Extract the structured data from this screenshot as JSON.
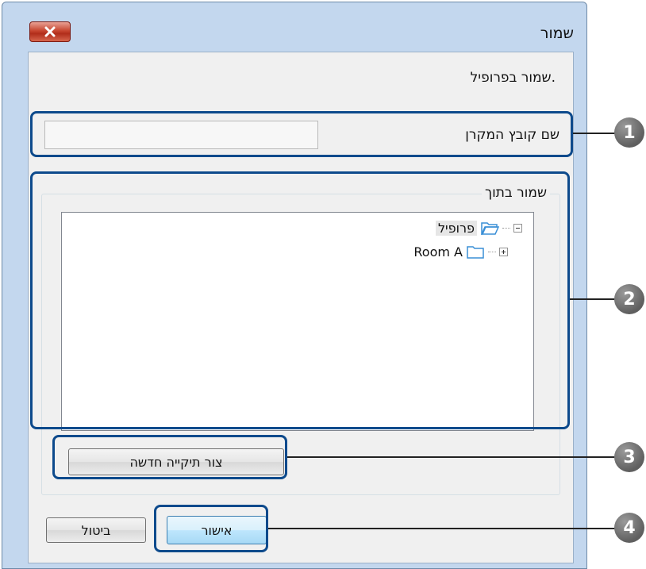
{
  "dialog": {
    "title": "שמור",
    "subtitle": "שמור בפרופיל.",
    "close_glyph": "close-icon"
  },
  "file_name": {
    "label": "שם קובץ המקרן",
    "value": ""
  },
  "save_in": {
    "label": "שמור בתוך",
    "tree": [
      {
        "label": "פרופיל",
        "expanded": true,
        "selected": true
      },
      {
        "label": "Room A",
        "expanded": false,
        "selected": false
      }
    ]
  },
  "buttons": {
    "new_folder": "צור תיקייה חדשה",
    "ok": "אישור",
    "cancel": "ביטול"
  },
  "callouts": [
    "1",
    "2",
    "3",
    "4"
  ],
  "colors": {
    "callout_box": "#0d4a8c",
    "callout_circle": "#6b6b6b",
    "close_button": "#c7452f",
    "window_frame": "#c3d7ee"
  }
}
